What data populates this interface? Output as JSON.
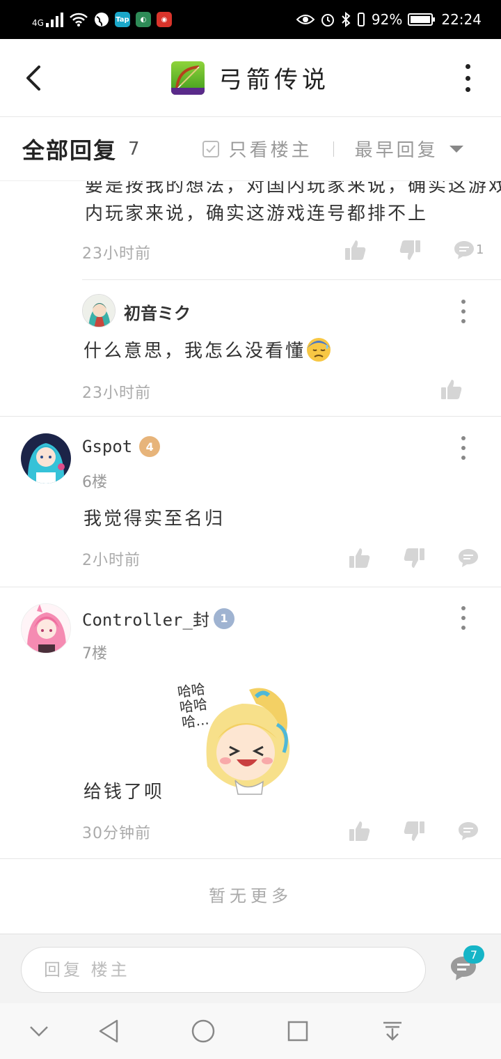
{
  "status_bar": {
    "network": "4G",
    "app_badges": [
      {
        "name": "tap",
        "label": "Tap",
        "color": "#1aa7c9"
      },
      {
        "name": "app2",
        "label": "",
        "color": "#2e8b57"
      },
      {
        "name": "app3",
        "label": "",
        "color": "#d9342b"
      }
    ],
    "battery": "92%",
    "time": "22:24"
  },
  "header": {
    "title": "弓箭传说",
    "back_icon": "chevron-left-icon",
    "more_icon": "more-vertical-icon"
  },
  "filter_bar": {
    "title": "全部回复",
    "count": "7",
    "only_owner_label": "只看楼主",
    "only_owner_checked": false,
    "sort_label": "最早回复"
  },
  "comments": {
    "partial": {
      "text_clipped": "要是按我的想法，对国内玩家来说，确实这游戏连号都排不上",
      "text_line2": "内玩家来说，确实这游戏连号都排不上",
      "time": "23小时前",
      "reply_count": "1"
    },
    "sub_reply": {
      "user": "初音ミク",
      "text": "什么意思，我怎么没看懂",
      "emoji": "sweat-sad-emoji",
      "time": "23小时前"
    },
    "floor6": {
      "user": "Gspot",
      "level": "4",
      "level_color": "#e7b47a",
      "floor": "6楼",
      "text": "我觉得实至名归",
      "time": "2小时前"
    },
    "floor7": {
      "user": "Controller_封",
      "level": "1",
      "level_color": "#9fb3d1",
      "floor": "7楼",
      "sticker_text": "哈哈哈哈哈...",
      "text": "给钱了呗",
      "time": "30分钟前"
    }
  },
  "no_more": "暂无更多",
  "reply_bar": {
    "placeholder": "回复 楼主",
    "comment_count": "7"
  },
  "nav_bar": {
    "buttons": [
      "hide-keyboard",
      "back",
      "home",
      "recents",
      "notifications"
    ]
  }
}
